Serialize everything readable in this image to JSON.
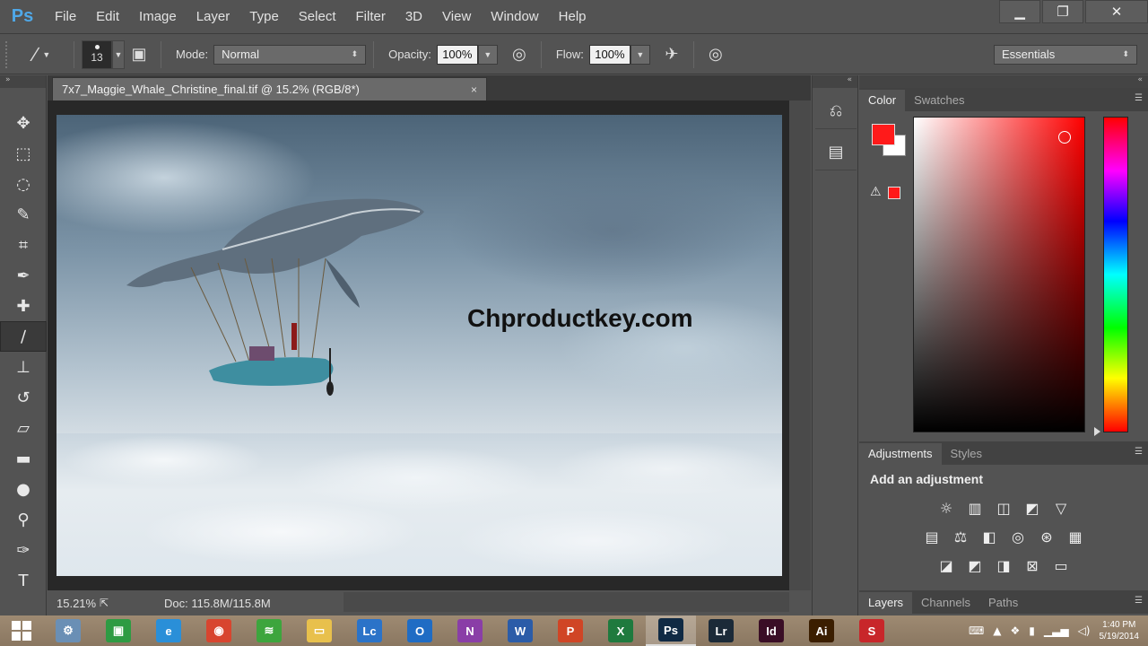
{
  "app": {
    "logo": "Ps",
    "menu": [
      "File",
      "Edit",
      "Image",
      "Layer",
      "Type",
      "Select",
      "Filter",
      "3D",
      "View",
      "Window",
      "Help"
    ],
    "window_controls": {
      "minimize": "▁",
      "restore": "❐",
      "close": "✕"
    }
  },
  "options": {
    "brush_size": "13",
    "mode_label": "Mode:",
    "mode_value": "Normal",
    "opacity_label": "Opacity:",
    "opacity_value": "100%",
    "flow_label": "Flow:",
    "flow_value": "100%",
    "workspace": "Essentials"
  },
  "tools": [
    {
      "name": "move-tool-icon",
      "glyph": "✥"
    },
    {
      "name": "marquee-tool-icon",
      "glyph": "⬚"
    },
    {
      "name": "lasso-tool-icon",
      "glyph": "◌"
    },
    {
      "name": "quick-select-tool-icon",
      "glyph": "✎"
    },
    {
      "name": "crop-tool-icon",
      "glyph": "⌗"
    },
    {
      "name": "eyedropper-tool-icon",
      "glyph": "✒"
    },
    {
      "name": "healing-brush-tool-icon",
      "glyph": "✚"
    },
    {
      "name": "brush-tool-icon",
      "glyph": "∕"
    },
    {
      "name": "stamp-tool-icon",
      "glyph": "⊥"
    },
    {
      "name": "history-brush-tool-icon",
      "glyph": "↺"
    },
    {
      "name": "eraser-tool-icon",
      "glyph": "▱"
    },
    {
      "name": "gradient-tool-icon",
      "glyph": "▬"
    },
    {
      "name": "blur-tool-icon",
      "glyph": "●"
    },
    {
      "name": "dodge-tool-icon",
      "glyph": "⚲"
    },
    {
      "name": "pen-tool-icon",
      "glyph": "✑"
    },
    {
      "name": "type-tool-icon",
      "glyph": "T"
    }
  ],
  "document": {
    "tab_title": "7x7_Maggie_Whale_Christine_final.tif @ 15.2% (RGB/8*)",
    "tab_close": "×",
    "watermark": "Chproductkey.com",
    "zoom": "15.21%",
    "doc_info": "Doc: 115.8M/115.8M"
  },
  "panels": {
    "color_tabs": [
      "Color",
      "Swatches"
    ],
    "adjustments_tabs": [
      "Adjustments",
      "Styles"
    ],
    "adjustments_title": "Add an adjustment",
    "adjustment_rows": [
      [
        "☼",
        "▥",
        "◫",
        "◩",
        "▽"
      ],
      [
        "▤",
        "⚖",
        "◧",
        "◎",
        "⊛",
        "▦"
      ],
      [
        "◪",
        "◩",
        "◨",
        "⊠",
        "▭"
      ]
    ],
    "layers_tabs": [
      "Layers",
      "Channels",
      "Paths"
    ]
  },
  "colors": {
    "foreground": "#ff1a1a",
    "background": "#ffffff",
    "ui_bg": "#535353"
  },
  "taskbar": {
    "apps": [
      {
        "name": "tools-app-icon",
        "label": "⚙",
        "bg": "#6a8fb5"
      },
      {
        "name": "store-app-icon",
        "label": "▣",
        "bg": "#2e9b43"
      },
      {
        "name": "ie-app-icon",
        "label": "e",
        "bg": "#2a8fd8"
      },
      {
        "name": "chrome-app-icon",
        "label": "◉",
        "bg": "#d8452f"
      },
      {
        "name": "spotify-app-icon",
        "label": "≋",
        "bg": "#3da53d"
      },
      {
        "name": "explorer-app-icon",
        "label": "▭",
        "bg": "#e8c04c"
      },
      {
        "name": "lync-app-icon",
        "label": "Lc",
        "bg": "#2b73c8"
      },
      {
        "name": "outlook-app-icon",
        "label": "O",
        "bg": "#1f6cc4"
      },
      {
        "name": "onenote-app-icon",
        "label": "N",
        "bg": "#8a3ea7"
      },
      {
        "name": "word-app-icon",
        "label": "W",
        "bg": "#2b5ca8"
      },
      {
        "name": "powerpoint-app-icon",
        "label": "P",
        "bg": "#d04525"
      },
      {
        "name": "excel-app-icon",
        "label": "X",
        "bg": "#1f7a3e"
      },
      {
        "name": "photoshop-app-icon",
        "label": "Ps",
        "bg": "#102a44",
        "active": true
      },
      {
        "name": "lightroom-app-icon",
        "label": "Lr",
        "bg": "#1b2a38"
      },
      {
        "name": "indesign-app-icon",
        "label": "Id",
        "bg": "#3a0e26"
      },
      {
        "name": "illustrator-app-icon",
        "label": "Ai",
        "bg": "#3b1e00"
      },
      {
        "name": "snagit-app-icon",
        "label": "S",
        "bg": "#c8262a"
      }
    ],
    "time": "1:40 PM",
    "date": "5/19/2014"
  }
}
